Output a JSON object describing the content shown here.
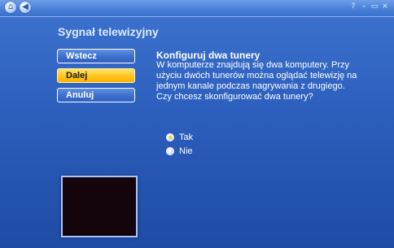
{
  "window": {
    "controls": [
      "?",
      "–",
      "▭",
      "×"
    ]
  },
  "sidebar": {
    "title": "Sygnał telewizyjny",
    "buttons": [
      {
        "label": "Wstecz",
        "active": false
      },
      {
        "label": "Dalej",
        "active": true
      },
      {
        "label": "Anuluj",
        "active": false
      }
    ]
  },
  "content": {
    "heading": "Konfiguruj dwa tunery",
    "body": "W komputerze znajdują się dwa komputery. Przy użyciu dwóch tunerów można oglądać telewizję na jednym kanale podczas nagrywania z drugiego. Czy chcesz skonfigurować dwa tunery?",
    "options": [
      {
        "label": "Tak",
        "selected": true
      },
      {
        "label": "Nie",
        "selected": false
      }
    ]
  },
  "colors": {
    "background": "#2c5fbd",
    "active_button": "#ffc51f"
  },
  "icons": {
    "home": "home-icon",
    "back": "back-arrow-icon"
  }
}
